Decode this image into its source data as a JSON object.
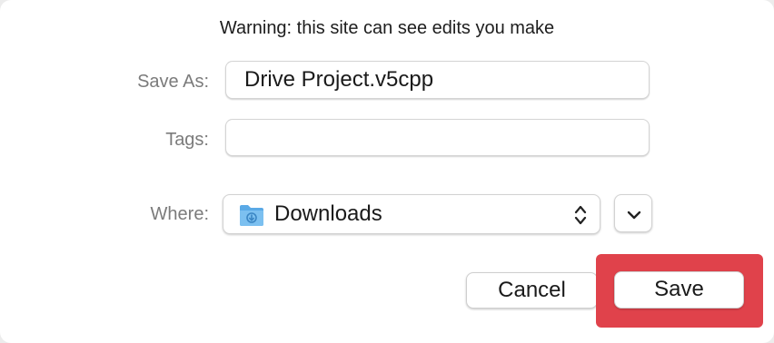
{
  "dialog": {
    "warning": "Warning: this site can see edits you make",
    "save_as_label": "Save As:",
    "save_as_value": "Drive Project.v5cpp",
    "tags_label": "Tags:",
    "tags_value": "",
    "where_label": "Where:",
    "where_value": "Downloads",
    "cancel_label": "Cancel",
    "save_label": "Save"
  },
  "icons": {
    "where_folder": "folder-icon",
    "where_popup": "up-down-chevron-icon",
    "expand": "chevron-down-icon"
  },
  "colors": {
    "highlight": "#e0424b",
    "folder": "#5aa9e6"
  }
}
